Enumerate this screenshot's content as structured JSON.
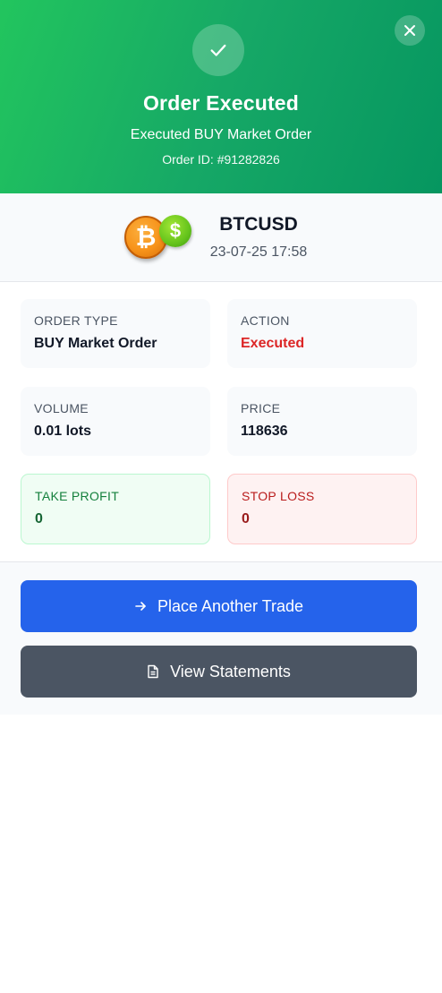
{
  "header": {
    "title": "Order Executed",
    "subtitle": "Executed BUY Market Order",
    "order_id": "Order ID: #91282826",
    "check_icon": "check-icon",
    "close_icon": "close-icon"
  },
  "symbol": {
    "name": "BTCUSD",
    "datetime": "23-07-25 17:58",
    "btc_glyph": "₿",
    "usd_glyph": "$"
  },
  "details": {
    "order_type": {
      "label": "ORDER TYPE",
      "value": "BUY Market Order"
    },
    "action": {
      "label": "ACTION",
      "value": "Executed",
      "color": "#dc2626"
    },
    "volume": {
      "label": "VOLUME",
      "value": "0.01 lots"
    },
    "price": {
      "label": "PRICE",
      "value": "118636"
    },
    "take_profit": {
      "label": "TAKE PROFIT",
      "value": "0",
      "color": "#166534"
    },
    "stop_loss": {
      "label": "STOP LOSS",
      "value": "0",
      "color": "#991b1b"
    }
  },
  "buttons": {
    "place_trade": {
      "label": "Place Another Trade",
      "icon": "arrow-right-icon",
      "color": "#2563eb"
    },
    "view_statements": {
      "label": "View Statements",
      "icon": "document-icon",
      "color": "#4b5563"
    }
  },
  "colors": {
    "header_gradient_start": "#22c55e",
    "header_gradient_end": "#069660"
  }
}
